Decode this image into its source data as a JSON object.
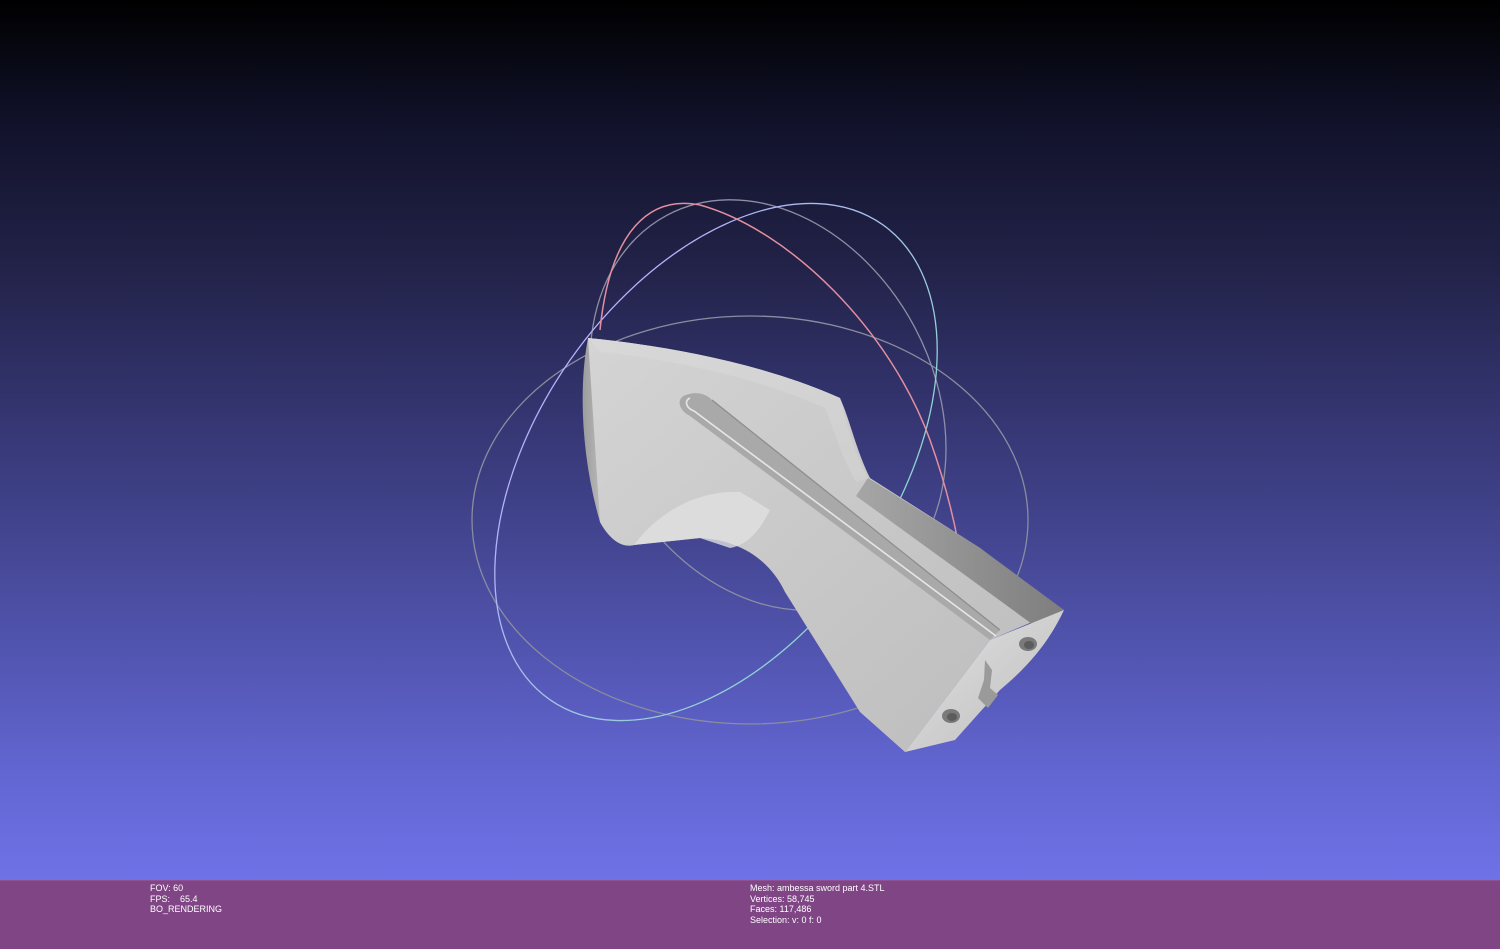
{
  "render_info": {
    "fov": "FOV: 60",
    "fps": "FPS:    65.4",
    "mode": "BO_RENDERING"
  },
  "mesh_info": {
    "mesh": "Mesh: ambessa sword part 4.STL",
    "vertices": "Vertices: 58,745",
    "faces": "Faces: 117,486",
    "selection": "Selection: v: 0 f: 0"
  },
  "colors": {
    "status_bar": "#7f4585",
    "background_top": "#000000",
    "background_bottom": "#6e72e6",
    "model": "#c8c8c8"
  }
}
